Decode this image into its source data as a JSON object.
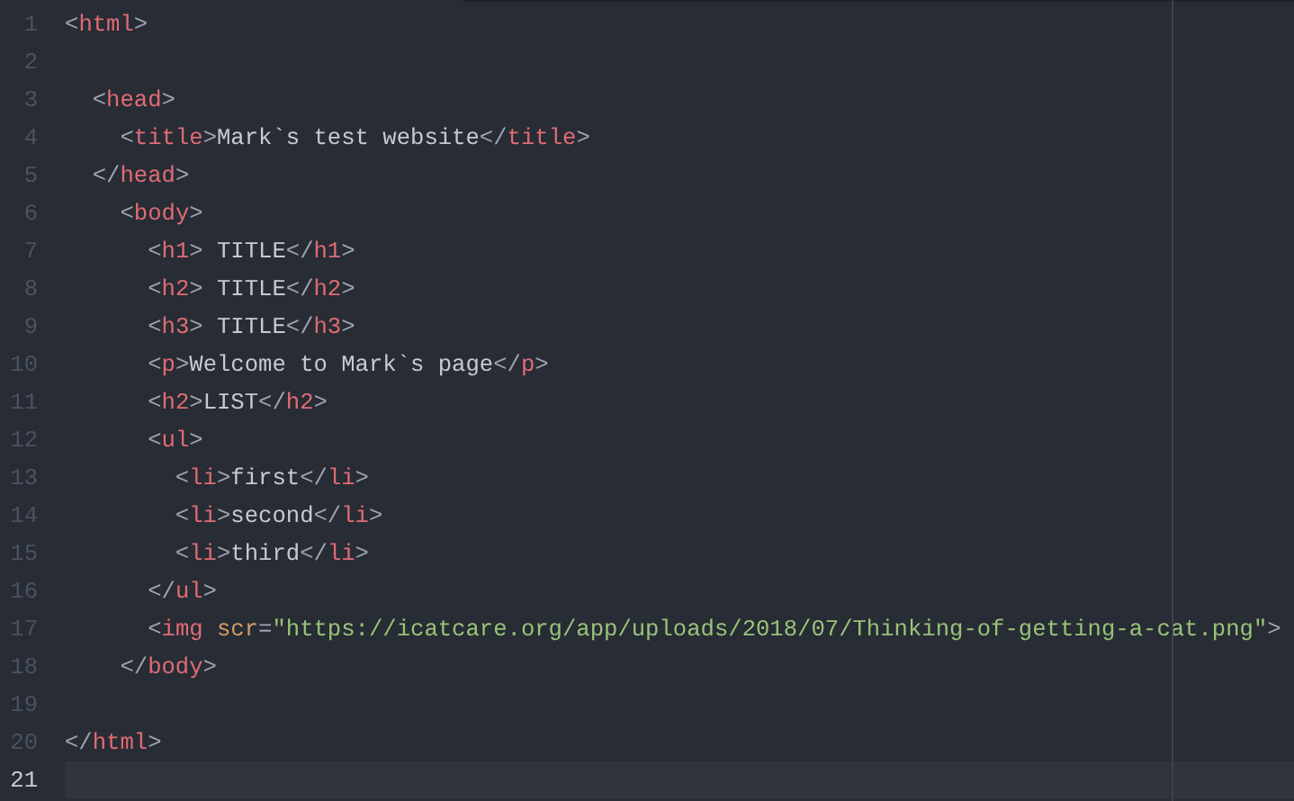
{
  "editor": {
    "lines": [
      {
        "number": "1",
        "current": false,
        "tokens": [
          {
            "kind": "punct",
            "text": "<"
          },
          {
            "kind": "tag",
            "text": "html"
          },
          {
            "kind": "punct",
            "text": ">"
          }
        ]
      },
      {
        "number": "2",
        "current": false
      },
      {
        "number": "3",
        "current": false,
        "tokens": [
          {
            "kind": "punct",
            "text": "  <"
          },
          {
            "kind": "tag",
            "text": "head"
          },
          {
            "kind": "punct",
            "text": ">"
          }
        ]
      },
      {
        "number": "4",
        "current": false,
        "tokens": [
          {
            "kind": "punct",
            "text": "    <"
          },
          {
            "kind": "tag",
            "text": "title"
          },
          {
            "kind": "punct",
            "text": ">"
          },
          {
            "kind": "text",
            "text": "Mark`s test website"
          },
          {
            "kind": "punct",
            "text": "</"
          },
          {
            "kind": "tag",
            "text": "title"
          },
          {
            "kind": "punct",
            "text": ">"
          }
        ]
      },
      {
        "number": "5",
        "current": false,
        "tokens": [
          {
            "kind": "punct",
            "text": "  </"
          },
          {
            "kind": "tag",
            "text": "head"
          },
          {
            "kind": "punct",
            "text": ">"
          }
        ]
      },
      {
        "number": "6",
        "current": false,
        "tokens": [
          {
            "kind": "punct",
            "text": "    <"
          },
          {
            "kind": "tag",
            "text": "body"
          },
          {
            "kind": "punct",
            "text": ">"
          }
        ]
      },
      {
        "number": "7",
        "current": false,
        "tokens": [
          {
            "kind": "punct",
            "text": "      <"
          },
          {
            "kind": "tag",
            "text": "h1"
          },
          {
            "kind": "punct",
            "text": ">"
          },
          {
            "kind": "text",
            "text": " TITLE"
          },
          {
            "kind": "punct",
            "text": "</"
          },
          {
            "kind": "tag",
            "text": "h1"
          },
          {
            "kind": "punct",
            "text": ">"
          }
        ]
      },
      {
        "number": "8",
        "current": false,
        "tokens": [
          {
            "kind": "punct",
            "text": "      <"
          },
          {
            "kind": "tag",
            "text": "h2"
          },
          {
            "kind": "punct",
            "text": ">"
          },
          {
            "kind": "text",
            "text": " TITLE"
          },
          {
            "kind": "punct",
            "text": "</"
          },
          {
            "kind": "tag",
            "text": "h2"
          },
          {
            "kind": "punct",
            "text": ">"
          }
        ]
      },
      {
        "number": "9",
        "current": false,
        "tokens": [
          {
            "kind": "punct",
            "text": "      <"
          },
          {
            "kind": "tag",
            "text": "h3"
          },
          {
            "kind": "punct",
            "text": ">"
          },
          {
            "kind": "text",
            "text": " TITLE"
          },
          {
            "kind": "punct",
            "text": "</"
          },
          {
            "kind": "tag",
            "text": "h3"
          },
          {
            "kind": "punct",
            "text": ">"
          }
        ]
      },
      {
        "number": "10",
        "current": false,
        "tokens": [
          {
            "kind": "punct",
            "text": "      <"
          },
          {
            "kind": "tag",
            "text": "p"
          },
          {
            "kind": "punct",
            "text": ">"
          },
          {
            "kind": "text",
            "text": "Welcome to Mark`s page"
          },
          {
            "kind": "punct",
            "text": "</"
          },
          {
            "kind": "tag",
            "text": "p"
          },
          {
            "kind": "punct",
            "text": ">"
          }
        ]
      },
      {
        "number": "11",
        "current": false,
        "tokens": [
          {
            "kind": "punct",
            "text": "      <"
          },
          {
            "kind": "tag",
            "text": "h2"
          },
          {
            "kind": "punct",
            "text": ">"
          },
          {
            "kind": "text",
            "text": "LIST"
          },
          {
            "kind": "punct",
            "text": "</"
          },
          {
            "kind": "tag",
            "text": "h2"
          },
          {
            "kind": "punct",
            "text": ">"
          }
        ]
      },
      {
        "number": "12",
        "current": false,
        "tokens": [
          {
            "kind": "punct",
            "text": "      <"
          },
          {
            "kind": "tag",
            "text": "ul"
          },
          {
            "kind": "punct",
            "text": ">"
          }
        ]
      },
      {
        "number": "13",
        "current": false,
        "tokens": [
          {
            "kind": "punct",
            "text": "        <"
          },
          {
            "kind": "tag",
            "text": "li"
          },
          {
            "kind": "punct",
            "text": ">"
          },
          {
            "kind": "text",
            "text": "first"
          },
          {
            "kind": "punct",
            "text": "</"
          },
          {
            "kind": "tag",
            "text": "li"
          },
          {
            "kind": "punct",
            "text": ">"
          }
        ]
      },
      {
        "number": "14",
        "current": false,
        "tokens": [
          {
            "kind": "punct",
            "text": "        <"
          },
          {
            "kind": "tag",
            "text": "li"
          },
          {
            "kind": "punct",
            "text": ">"
          },
          {
            "kind": "text",
            "text": "second"
          },
          {
            "kind": "punct",
            "text": "</"
          },
          {
            "kind": "tag",
            "text": "li"
          },
          {
            "kind": "punct",
            "text": ">"
          }
        ]
      },
      {
        "number": "15",
        "current": false,
        "tokens": [
          {
            "kind": "punct",
            "text": "        <"
          },
          {
            "kind": "tag",
            "text": "li"
          },
          {
            "kind": "punct",
            "text": ">"
          },
          {
            "kind": "text",
            "text": "third"
          },
          {
            "kind": "punct",
            "text": "</"
          },
          {
            "kind": "tag",
            "text": "li"
          },
          {
            "kind": "punct",
            "text": ">"
          }
        ]
      },
      {
        "number": "16",
        "current": false,
        "tokens": [
          {
            "kind": "punct",
            "text": "      </"
          },
          {
            "kind": "tag",
            "text": "ul"
          },
          {
            "kind": "punct",
            "text": ">"
          }
        ]
      },
      {
        "number": "17",
        "current": false,
        "tokens": [
          {
            "kind": "punct",
            "text": "      <"
          },
          {
            "kind": "tag",
            "text": "img"
          },
          {
            "kind": "attr",
            "text": " scr"
          },
          {
            "kind": "punct",
            "text": "="
          },
          {
            "kind": "string",
            "text": "\"https://icatcare.org/app/uploads/2018/07/Thinking-of-getting-a-cat.png\""
          },
          {
            "kind": "punct",
            "text": ">"
          }
        ]
      },
      {
        "number": "18",
        "current": false,
        "tokens": [
          {
            "kind": "punct",
            "text": "    </"
          },
          {
            "kind": "tag",
            "text": "body"
          },
          {
            "kind": "punct",
            "text": ">"
          }
        ]
      },
      {
        "number": "19",
        "current": false
      },
      {
        "number": "20",
        "current": false,
        "tokens": [
          {
            "kind": "punct",
            "text": "</"
          },
          {
            "kind": "tag",
            "text": "html"
          },
          {
            "kind": "punct",
            "text": ">"
          }
        ]
      },
      {
        "number": "21",
        "current": true
      }
    ]
  }
}
